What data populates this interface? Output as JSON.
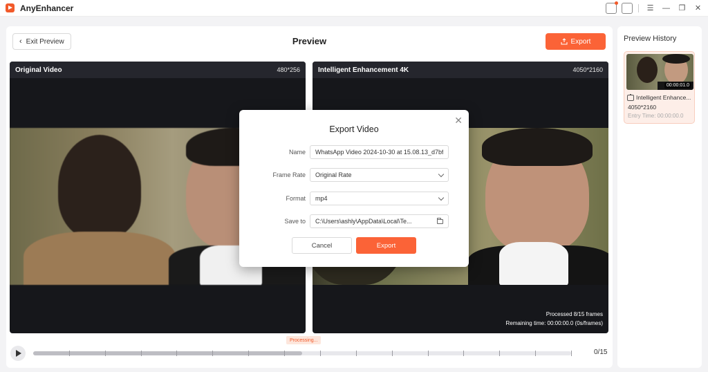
{
  "app": {
    "name": "AnyEnhancer"
  },
  "header": {
    "exit_label": "Exit Preview",
    "title": "Preview",
    "export_label": "Export"
  },
  "original": {
    "title": "Original Video",
    "resolution": "480*256"
  },
  "enhanced": {
    "title": "Intelligent Enhancement 4K",
    "resolution": "4050*2160",
    "processed": "Processed 8/15 frames",
    "remaining": "Remaining time: 00:00:00.0 (0s/frames)"
  },
  "timeline": {
    "processing_label": "Processing...",
    "frame_count": "0/15",
    "progress": 0.5
  },
  "history": {
    "title": "Preview History",
    "item": {
      "time": "00:00:01.0",
      "name": "Intelligent Enhance...",
      "resolution": "4050*2160",
      "entry_time": "Entry Time: 00:00:00.0"
    }
  },
  "dialog": {
    "title": "Export Video",
    "name_label": "Name",
    "name_value": "WhatsApp Video 2024-10-30 at 15.08.13_d7bf",
    "frame_rate_label": "Frame Rate",
    "frame_rate_value": "Original Rate",
    "format_label": "Format",
    "format_value": "mp4",
    "save_to_label": "Save to",
    "save_to_value": "C:\\Users\\ashly\\AppData\\Local\\Te...",
    "cancel_label": "Cancel",
    "export_label": "Export"
  },
  "colors": {
    "accent": "#fb6337",
    "pane_bg": "#16171b"
  }
}
